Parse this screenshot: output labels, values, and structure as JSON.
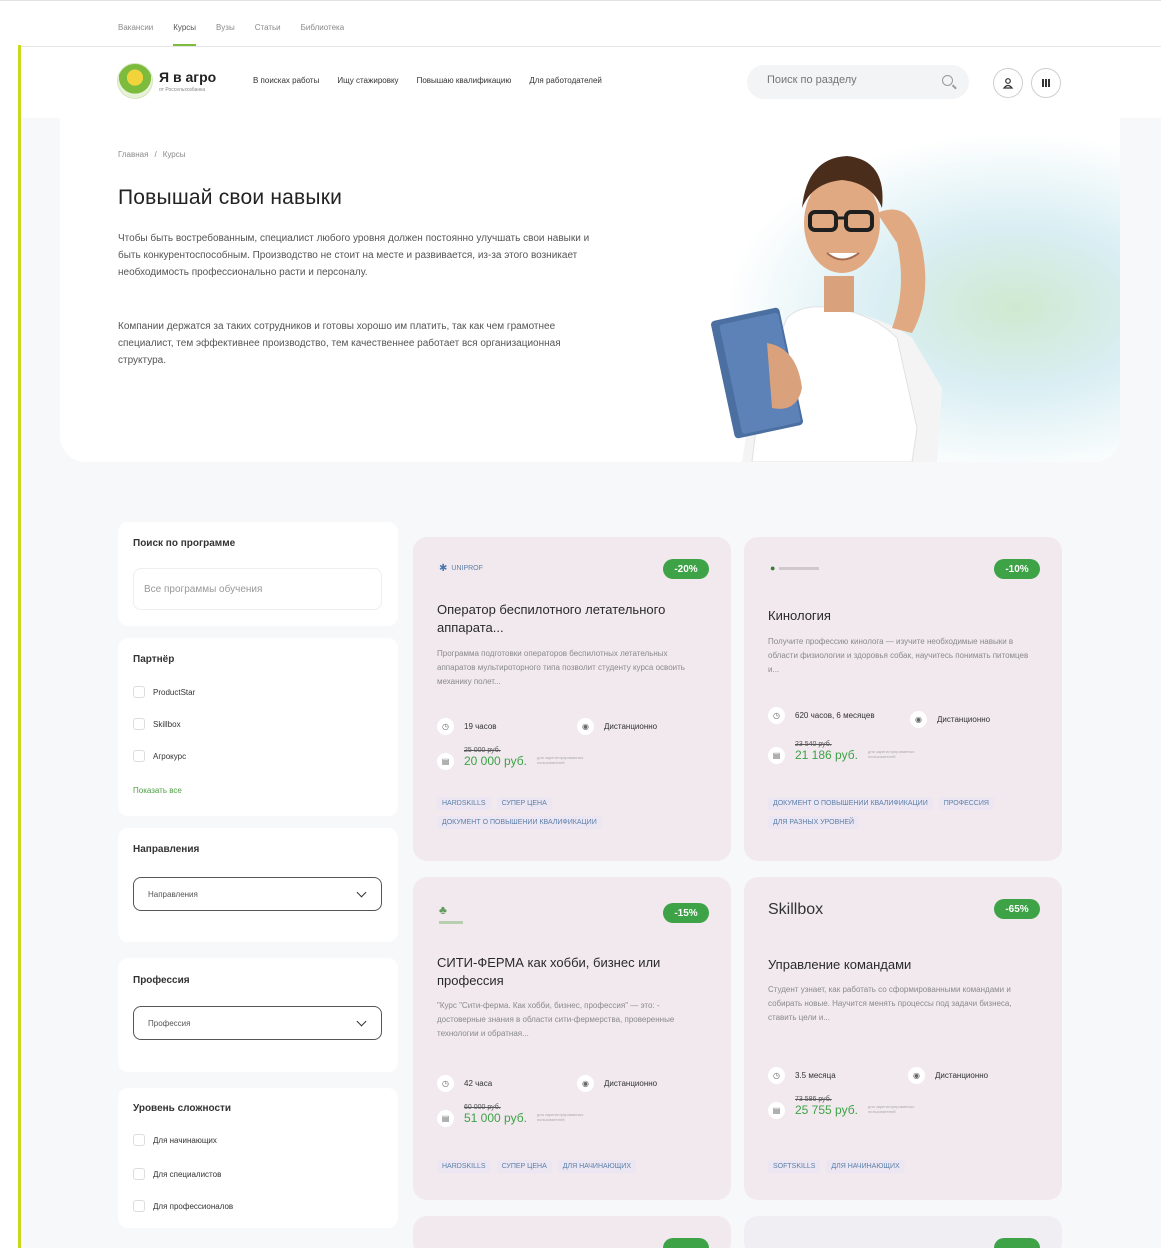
{
  "topbar": {
    "tabs": [
      "Вакансии",
      "Курсы",
      "Вузы",
      "Статьи",
      "Библиотека"
    ],
    "active": "Курсы"
  },
  "header": {
    "logo_title": "Я в агро",
    "logo_sub": "от Россельхозбанка",
    "nav": [
      "В поисках работы",
      "Ищу стажировку",
      "Повышаю квалификацию",
      "Для работодателей"
    ],
    "search_placeholder": "Поиск по разделу"
  },
  "hero": {
    "breadcrumb": [
      "Главная",
      "/",
      "Курсы"
    ],
    "title": "Повышай свои навыки",
    "p1": "Чтобы быть востребованным, специалист любого уровня должен постоянно улучшать свои навыки и быть конкурентоспособным. Производство не стоит на месте и развивается, из-за этого возникает необходимость профессионально расти и персоналу.",
    "p2": "Компании держатся за таких сотрудников и готовы хорошо им платить, так как чем грамотнее специалист, тем эффективнее производство, тем качественнее работает вся организационная структура."
  },
  "filters": {
    "search": {
      "title": "Поиск по программе",
      "placeholder": "Все программы обучения"
    },
    "partner": {
      "title": "Партнёр",
      "items": [
        "ProductStar",
        "Skillbox",
        "Агрокурс"
      ],
      "show_all": "Показать все"
    },
    "direction": {
      "title": "Направления",
      "value": "Направления"
    },
    "profession": {
      "title": "Профессия",
      "value": "Профессия"
    },
    "level": {
      "title": "Уровень сложности",
      "items": [
        "Для начинающих",
        "Для специалистов",
        "Для профессионалов"
      ]
    }
  },
  "courses": [
    {
      "partner": "UNIPROF",
      "discount": "-20%",
      "title": "Оператор беспилотного летательного аппарата...",
      "desc": "Программа подготовки операторов беспилотных летательных аппаратов мультироторного типа позволит студенту курса освоить механику полет...",
      "duration": "19 часов",
      "format": "Дистанционно",
      "old_price": "25 000 руб.",
      "price": "20 000 руб.",
      "price_note": "для зарегистрированных пользователей",
      "tags": [
        "HARDSKILLS",
        "СУПЕР ЦЕНА",
        "ДОКУМЕНТ О ПОВЫШЕНИИ КВАЛИФИКАЦИИ"
      ]
    },
    {
      "partner": "",
      "discount": "-10%",
      "title": "Кинология",
      "desc": "Получите профессию кинолога — изучите необходимые навыки в области физиологии и здоровья собак, научитесь понимать питомцев и...",
      "duration": "620 часов, 6 месяцев",
      "format": "Дистанционно",
      "old_price": "23 540 руб.",
      "price": "21 186 руб.",
      "price_note": "для зарегистрированных пользователей",
      "tags": [
        "ДОКУМЕНТ О ПОВЫШЕНИИ КВАЛИФИКАЦИИ",
        "ПРОФЕССИЯ",
        "ДЛЯ РАЗНЫХ УРОВНЕЙ"
      ]
    },
    {
      "partner": "",
      "discount": "-15%",
      "title": "СИТИ-ФЕРМА как хобби, бизнес или профессия",
      "desc": "\"Курс \"Сити-ферма. Как хобби, бизнес, профессия\" — это: - достоверные знания в области сити-фермерства, проверенные технологии и обратная...",
      "duration": "42 часа",
      "format": "Дистанционно",
      "old_price": "60 000 руб.",
      "price": "51 000 руб.",
      "price_note": "для зарегистрированных пользователей",
      "tags": [
        "HARDSKILLS",
        "СУПЕР ЦЕНА",
        "ДЛЯ НАЧИНАЮЩИХ"
      ]
    },
    {
      "partner": "Skillbox",
      "discount": "-65%",
      "title": "Управление командами",
      "desc": "Студент узнает, как работать со сформированными командами и собирать новые. Научится менять процессы под задачи бизнеса, ставить цели и...",
      "duration": "3.5 месяца",
      "format": "Дистанционно",
      "old_price": "73 586 руб.",
      "price": "25 755 руб.",
      "price_note": "для зарегистрированных пользователей",
      "tags": [
        "SOFTSKILLS",
        "ДЛЯ НАЧИНАЮЩИХ"
      ]
    }
  ],
  "colors": {
    "accent_green": "#3ea247",
    "card_bg": "#f1e9ee",
    "frame_line": "#c9d81a"
  },
  "icons": {
    "clock": "clock-icon",
    "format": "location-icon",
    "price": "wallet-icon",
    "user": "user-icon",
    "menu": "menu-icon"
  }
}
